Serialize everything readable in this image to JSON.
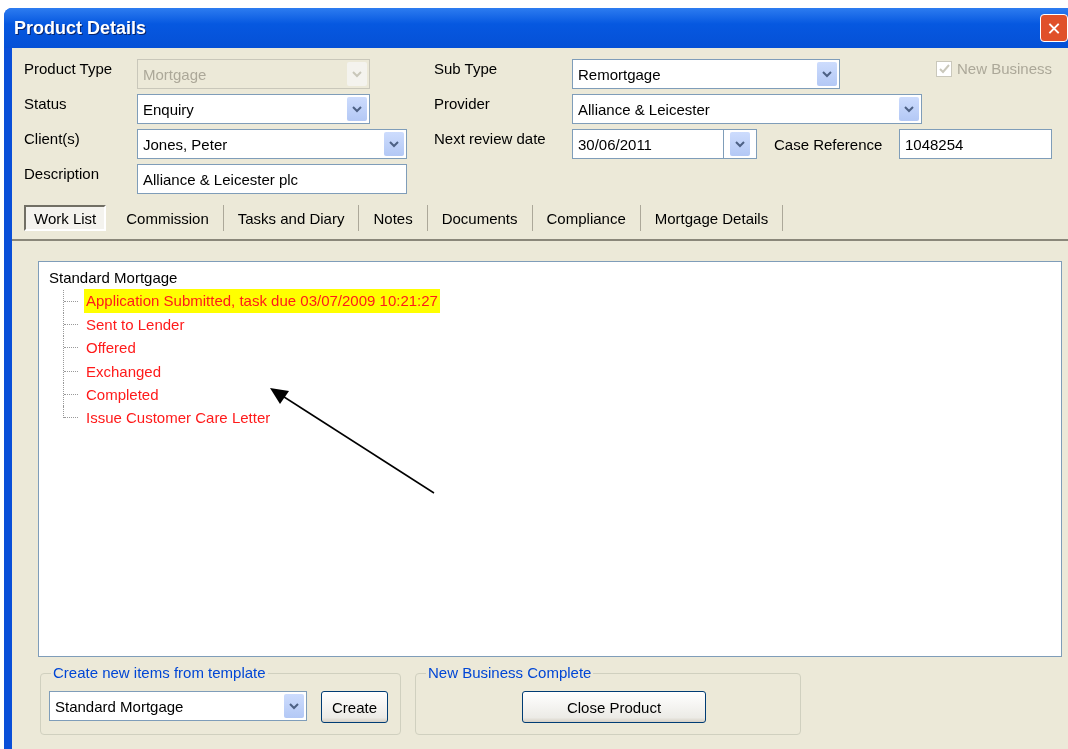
{
  "window": {
    "title": "Product Details",
    "close_button": "✕"
  },
  "form": {
    "product_type": {
      "label": "Product Type",
      "value": "Mortgage",
      "disabled": true
    },
    "sub_type": {
      "label": "Sub Type",
      "value": "Remortgage",
      "disabled": false
    },
    "new_business": {
      "label": "New Business",
      "checked": true,
      "disabled": true
    },
    "status": {
      "label": "Status",
      "value": "Enquiry",
      "disabled": false
    },
    "provider": {
      "label": "Provider",
      "value": "Alliance & Leicester",
      "disabled": false
    },
    "clients": {
      "label": "Client(s)",
      "value": "Jones, Peter",
      "disabled": false
    },
    "next_review_date": {
      "label": "Next review date",
      "value": "30/06/2011"
    },
    "case_reference": {
      "label": "Case Reference",
      "value": "1048254"
    },
    "description": {
      "label": "Description",
      "value": "Alliance & Leicester plc"
    }
  },
  "tabs": [
    {
      "label": "Work List",
      "selected": true
    },
    {
      "label": "Commission",
      "selected": false
    },
    {
      "label": "Tasks and Diary",
      "selected": false
    },
    {
      "label": "Notes",
      "selected": false
    },
    {
      "label": "Documents",
      "selected": false
    },
    {
      "label": "Compliance",
      "selected": false
    },
    {
      "label": "Mortgage Details",
      "selected": false
    }
  ],
  "work_list": {
    "label": "Standard Mortgage",
    "children": [
      {
        "label": "Application Submitted, task due 03/07/2009 10:21:27",
        "highlighted": true
      },
      {
        "label": "Sent to Lender",
        "highlighted": false
      },
      {
        "label": "Offered",
        "highlighted": false
      },
      {
        "label": "Exchanged",
        "highlighted": false
      },
      {
        "label": "Completed",
        "highlighted": false
      },
      {
        "label": "Issue Customer Care Letter",
        "highlighted": false
      }
    ]
  },
  "template_group": {
    "title": "Create new items from template",
    "value": "Standard Mortgage",
    "button": "Create"
  },
  "complete_group": {
    "title": "New Business Complete",
    "button": "Close Product"
  }
}
